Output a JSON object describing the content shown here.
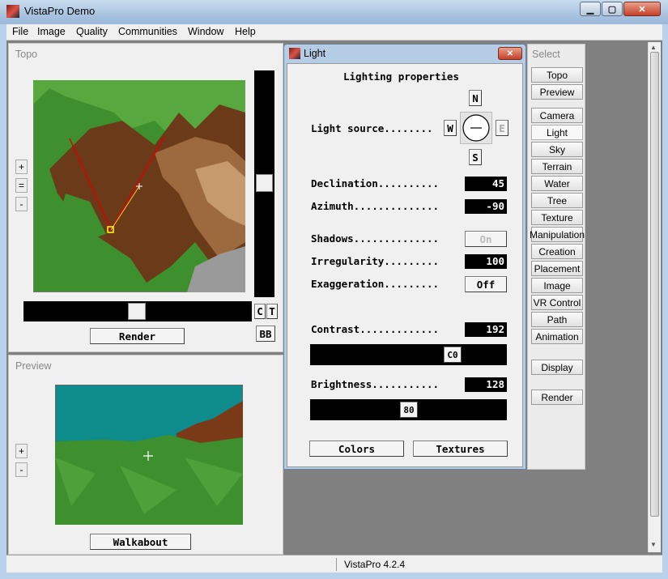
{
  "window": {
    "title": "VistaPro Demo"
  },
  "menu": [
    "File",
    "Image",
    "Quality",
    "Communities",
    "Window",
    "Help"
  ],
  "topo": {
    "title": "Topo",
    "zoom_in": "+",
    "zoom_reset": "=",
    "zoom_out": "-",
    "render_label": "Render",
    "c_label": "C",
    "t_label": "T",
    "bb_label": "BB"
  },
  "preview": {
    "title": "Preview",
    "zoom_in": "+",
    "zoom_out": "-",
    "walkabout_label": "Walkabout"
  },
  "light": {
    "title": "Light",
    "heading": "Lighting properties",
    "light_source_label": "Light source........",
    "compass": {
      "n": "N",
      "s": "S",
      "w": "W",
      "e": "E"
    },
    "declination_label": "Declination..........",
    "declination": "45",
    "azimuth_label": "Azimuth..............",
    "azimuth": "-90",
    "shadows_label": "Shadows..............",
    "shadows": "On",
    "irregularity_label": "Irregularity.........",
    "irregularity": "100",
    "exaggeration_label": "Exaggeration.........",
    "exaggeration": "Off",
    "contrast_label": "Contrast.............",
    "contrast": "192",
    "contrast_slider": "C0",
    "contrast_level": 0.75,
    "brightness_label": "Brightness...........",
    "brightness": "128",
    "brightness_slider": "80",
    "brightness_level": 0.5,
    "colors_label": "Colors",
    "textures_label": "Textures"
  },
  "select": {
    "title": "Select",
    "group1": [
      "Topo",
      "Preview"
    ],
    "group2": [
      "Camera",
      "Light",
      "Sky",
      "Terrain",
      "Water",
      "Tree",
      "Texture",
      "Manipulation",
      "Creation",
      "Placement",
      "Image",
      "VR Control",
      "Path",
      "Animation"
    ],
    "active": "Light",
    "display_label": "Display",
    "render_label": "Render"
  },
  "status": {
    "text": "VistaPro 4.2.4"
  },
  "colors": {
    "titlebar": "#a9c4e0",
    "terrain_green": "#3e8f2e",
    "terrain_brown": "#6b3a18",
    "sky": "#0e8c8c",
    "close_red": "#c6402a"
  }
}
